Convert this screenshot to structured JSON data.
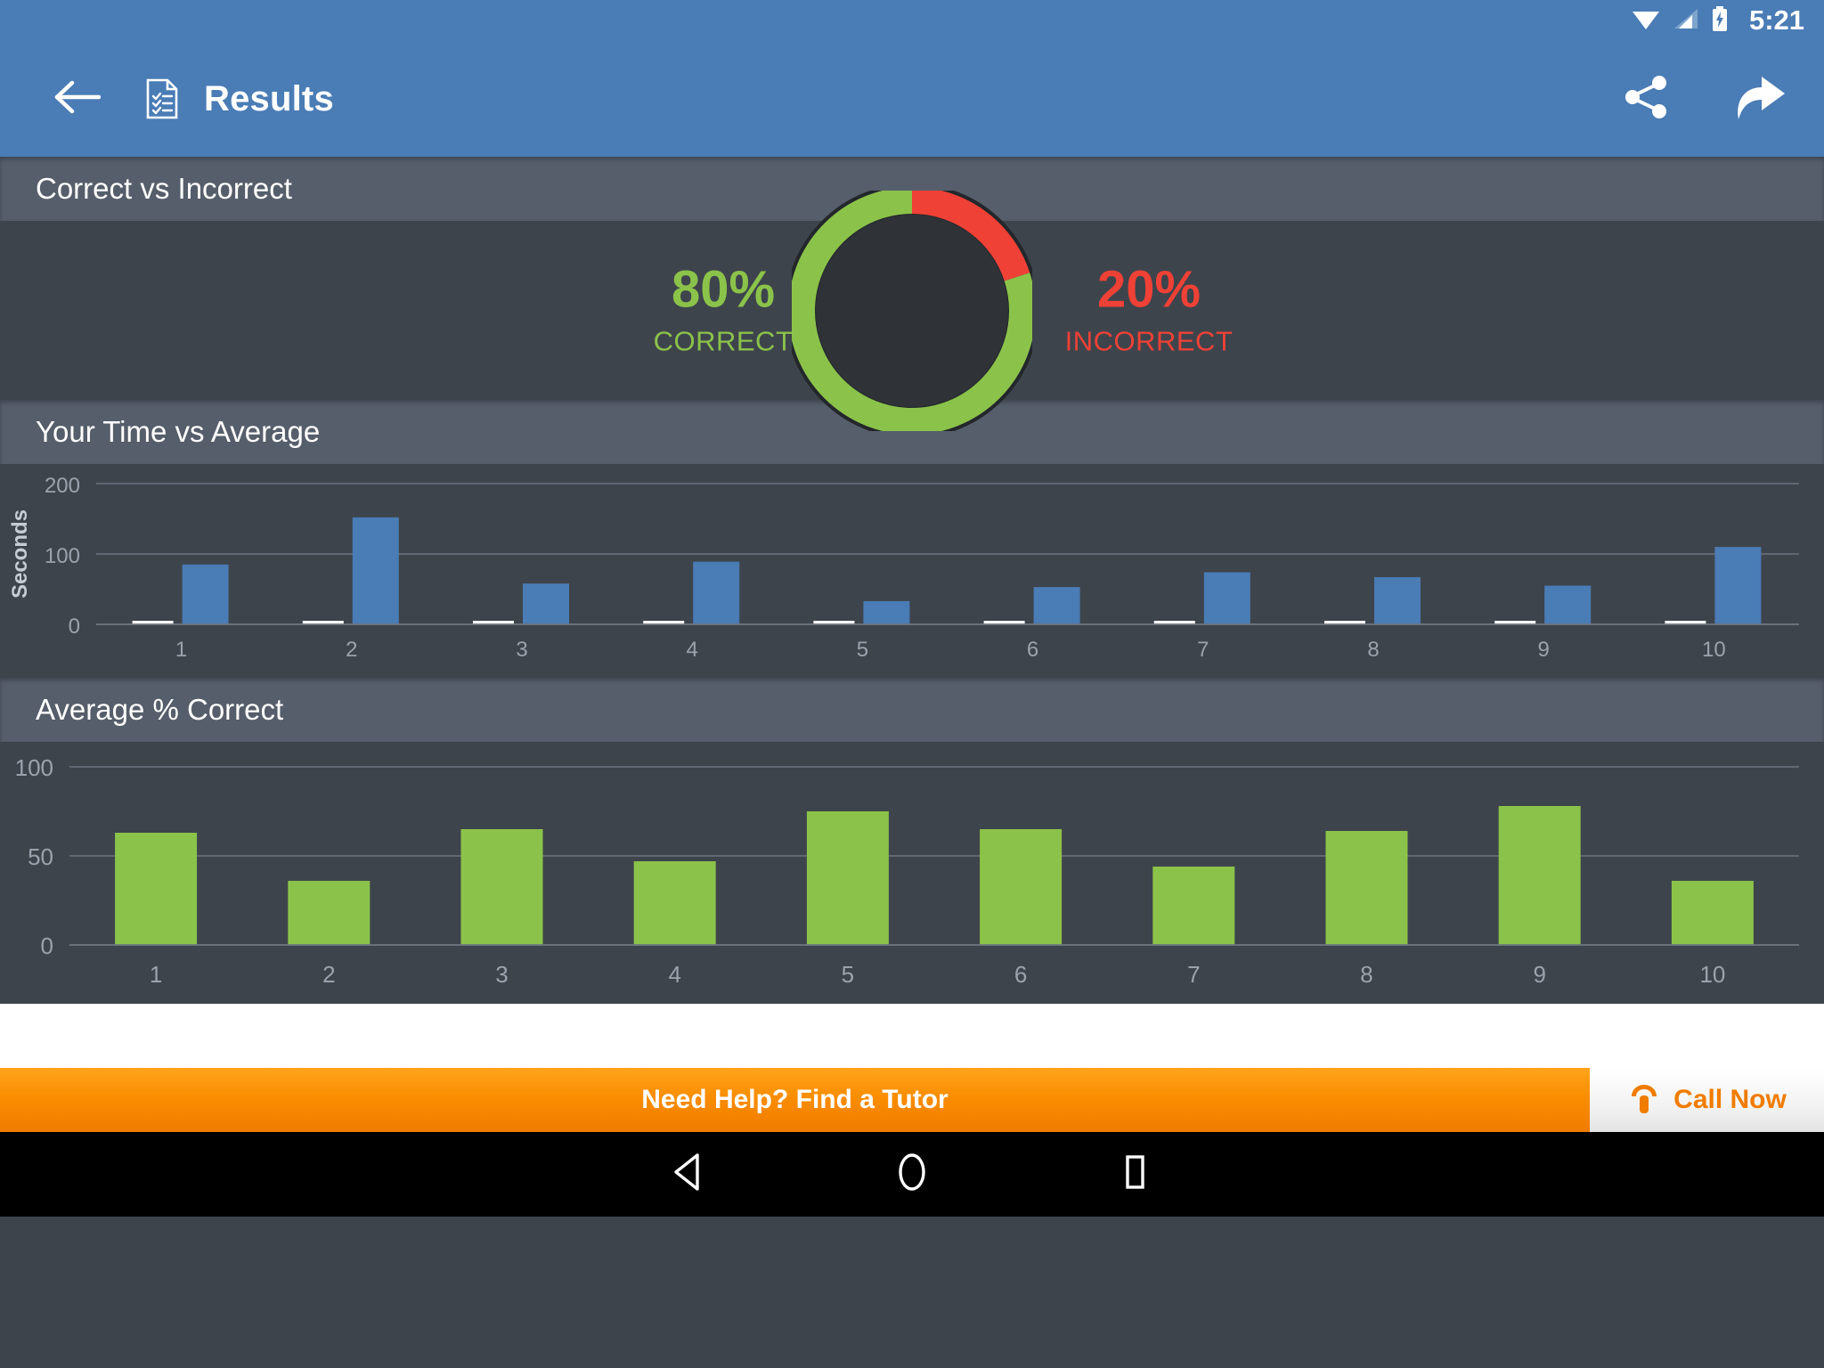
{
  "statusbar": {
    "time": "5:21",
    "icons": [
      "wifi-icon",
      "cellular-signal-icon",
      "battery-charging-icon"
    ]
  },
  "appbar": {
    "back_label": "back-arrow",
    "doc_icon": "results-document-icon",
    "title": "Results",
    "share_label": "share-icon",
    "forward_label": "forward-arrow-icon"
  },
  "sections": {
    "correct_vs_incorrect": {
      "title": "Correct vs Incorrect",
      "correct_value": "80%",
      "correct_label": "CORRECT",
      "incorrect_value": "20%",
      "incorrect_label": "INCORRECT",
      "correct_color": "#8bc34a",
      "incorrect_color": "#ef4136",
      "donut_hole_color": "#2f3337"
    },
    "time_vs_average": {
      "title": "Your Time vs Average"
    },
    "average_pct_correct": {
      "title": "Average % Correct"
    }
  },
  "colors": {
    "accent_blue": "#4a7cb5",
    "panel_bg": "#3e444c",
    "header_bg": "#565e6b",
    "bar_blue": "#4a7cb5",
    "bar_green": "#8bc34a",
    "bar_white": "#ffffff",
    "orange": "#f98c00"
  },
  "ad": {
    "message": "Need Help? Find a Tutor",
    "call_label": "Call Now",
    "phone_icon": "phone-icon"
  },
  "navbar": {
    "back": "nav-back-triangle",
    "home": "nav-home-circle",
    "recents": "nav-recents-square"
  },
  "chart_data": [
    {
      "id": "time_vs_average",
      "type": "bar",
      "title": "Your Time vs Average",
      "xlabel": "",
      "ylabel": "Seconds",
      "categories": [
        "1",
        "2",
        "3",
        "4",
        "5",
        "6",
        "7",
        "8",
        "9",
        "10"
      ],
      "yticks": [
        0,
        100,
        200
      ],
      "ylim": [
        0,
        200
      ],
      "grid": true,
      "legend": "none",
      "series": [
        {
          "name": "Average",
          "color": "#ffffff",
          "values": [
            5,
            5,
            5,
            5,
            5,
            5,
            5,
            5,
            5,
            5
          ]
        },
        {
          "name": "Your Time",
          "color": "#4a7cb5",
          "values": [
            85,
            152,
            58,
            89,
            33,
            53,
            74,
            67,
            55,
            110
          ]
        }
      ]
    },
    {
      "id": "average_pct_correct",
      "type": "bar",
      "title": "Average % Correct",
      "xlabel": "",
      "ylabel": "",
      "categories": [
        "1",
        "2",
        "3",
        "4",
        "5",
        "6",
        "7",
        "8",
        "9",
        "10"
      ],
      "yticks": [
        0,
        50,
        100
      ],
      "ylim": [
        0,
        100
      ],
      "grid": true,
      "legend": "none",
      "series": [
        {
          "name": "Average % Correct",
          "color": "#8bc34a",
          "values": [
            63,
            36,
            65,
            47,
            75,
            65,
            44,
            64,
            78,
            36
          ]
        }
      ]
    }
  ]
}
